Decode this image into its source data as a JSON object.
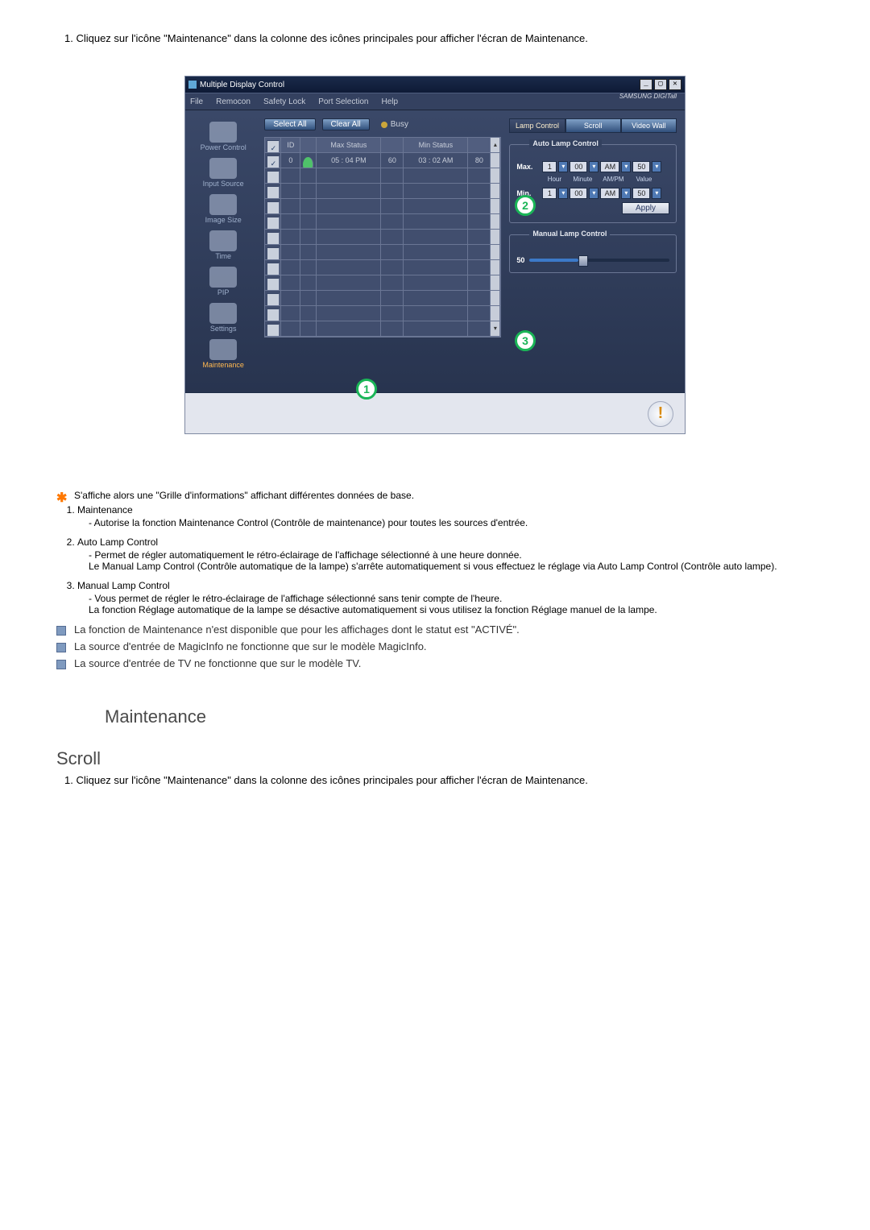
{
  "intro_top": "1.  Cliquez sur l'icône \"Maintenance\" dans la colonne des icônes principales pour afficher l'écran de Maintenance.",
  "app": {
    "title": "Multiple Display Control",
    "menu": [
      "File",
      "Remocon",
      "Safety Lock",
      "Port Selection",
      "Help"
    ],
    "brand": "SAMSUNG DIGITall",
    "select_all": "Select All",
    "clear_all": "Clear All",
    "busy": "Busy",
    "nav": [
      {
        "label": "Power Control"
      },
      {
        "label": "Input Source"
      },
      {
        "label": "Image Size"
      },
      {
        "label": "Time"
      },
      {
        "label": "PIP"
      },
      {
        "label": "Settings"
      },
      {
        "label": "Maintenance",
        "selected": true
      }
    ],
    "grid": {
      "headers": {
        "chk": "✓",
        "id": "ID",
        "s": "",
        "max": "Max Status",
        "v1": "",
        "min": "Min Status",
        "v2": "",
        "sc": ""
      },
      "row": {
        "id": "0",
        "max_time": "05 : 04 PM",
        "max_val": "60",
        "min_time": "03 : 02 AM",
        "min_val": "80"
      }
    },
    "tabs": {
      "lamp": "Lamp Control",
      "scroll": "Scroll",
      "video": "Video Wall"
    },
    "auto_group": {
      "title": "Auto Lamp Control",
      "max_label": "Max.",
      "min_label": "Min.",
      "cols": {
        "hour": "Hour",
        "minute": "Minute",
        "ampm": "AM/PM",
        "value": "Value"
      },
      "max": {
        "hour": "1",
        "minute": "00",
        "ampm": "AM",
        "value": "50"
      },
      "min": {
        "hour": "1",
        "minute": "00",
        "ampm": "AM",
        "value": "50"
      },
      "apply": "Apply"
    },
    "manual_group": {
      "title": "Manual Lamp Control",
      "value": "50"
    }
  },
  "badges": {
    "b1": "1",
    "b2": "2",
    "b3": "3"
  },
  "star_note": "S'affiche alors une \"Grille d'informations\" affichant différentes données de base.",
  "items": [
    {
      "num": "1)",
      "title": "Maintenance",
      "lines": [
        "- Autorise la fonction Maintenance Control (Contrôle de maintenance) pour toutes les sources d'entrée."
      ]
    },
    {
      "num": "2)",
      "title": "Auto Lamp Control",
      "lines": [
        "- Permet de régler automatiquement le rétro-éclairage de l'affichage sélectionné à une heure donnée.",
        "Le Manual Lamp Control (Contrôle automatique de la lampe) s'arrête automatiquement si vous effectuez le réglage via Auto Lamp Control (Contrôle auto lampe)."
      ]
    },
    {
      "num": "3)",
      "title": "Manual Lamp Control",
      "lines": [
        "- Vous permet de régler le rétro-éclairage de l'affichage sélectionné sans tenir compte de l'heure.",
        "La fonction Réglage automatique de la lampe se désactive automatiquement si vous utilisez la fonction Réglage manuel de la lampe."
      ]
    }
  ],
  "sq_notes": [
    "La fonction de Maintenance n'est disponible que pour les affichages dont le statut est \"ACTIVÉ\".",
    "La source d'entrée de MagicInfo ne fonctionne que sur le modèle MagicInfo.",
    "La source d'entrée de TV ne fonctionne que sur le modèle TV."
  ],
  "section_heading": "Maintenance",
  "sub_heading": "Scroll",
  "intro_bottom": "1.  Cliquez sur l'icône \"Maintenance\" dans la colonne des icônes principales pour afficher l'écran de Maintenance."
}
